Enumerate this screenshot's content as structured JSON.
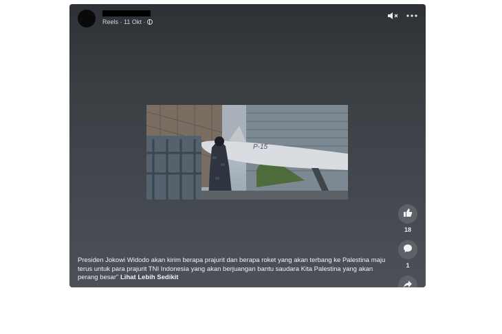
{
  "post": {
    "meta_text": "Reels · 11 Okt ·",
    "caption": "Presiden Jokowi Widodo akan kirim berapa prajurit dan berapa roket yang akan terbang  ke Palestina maju terus untuk para  prajurit TNI Indonesia yang akan berjuangan bantu saudara Kita Palestina yang akan perang besar\"",
    "see_more": "Lihat Lebih Sedikit"
  },
  "video": {
    "missile_label": "P-15"
  },
  "actions": {
    "like_count": "18",
    "comment_count": "1"
  },
  "icons": [
    "speaker-muted-icon",
    "more-icon",
    "like-icon",
    "comment-icon",
    "share-icon",
    "globe-icon"
  ]
}
